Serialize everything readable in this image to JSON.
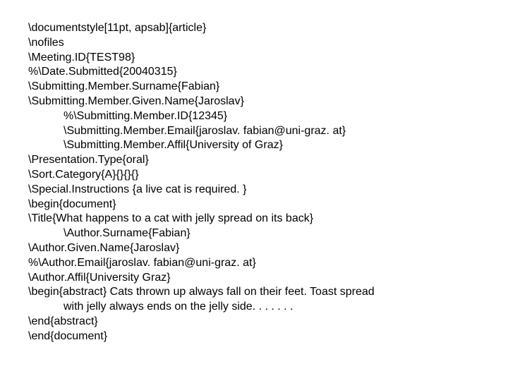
{
  "lines": {
    "l0": "\\documentstyle[11pt, apsab]{article}",
    "l1": "\\nofiles",
    "l2": "\\Meeting.ID{TEST98}",
    "l3": "%\\Date.Submitted{20040315}",
    "l4": "\\Submitting.Member.Surname{Fabian}",
    "l5": "\\Submitting.Member.Given.Name{Jaroslav}",
    "l6": "%\\Submitting.Member.ID{12345}",
    "l7": "\\Submitting.Member.Email{jaroslav. fabian@uni-graz. at}",
    "l8": "\\Submitting.Member.Affil{University of Graz}",
    "l9": "\\Presentation.Type{oral}",
    "l10": "\\Sort.Category{A}{}{}{}",
    "l11": "\\Special.Instructions {a live cat is required. }",
    "l12": "\\begin{document}",
    "l13": "\\Title{What happens to a cat with jelly spread on its back}",
    "l14": "\\Author.Surname{Fabian}",
    "l15": "\\Author.Given.Name{Jaroslav}",
    "l16": "%\\Author.Email{jaroslav. fabian@uni-graz. at}",
    "l17": "\\Author.Affil{University Graz}",
    "l18a": "\\begin{abstract} Cats thrown up always fall on their feet. Toast spread",
    "l18b": "with jelly always ends on the jelly side. . . . . . .",
    "l19": "\\end{abstract}",
    "l20": "\\end{document}"
  }
}
